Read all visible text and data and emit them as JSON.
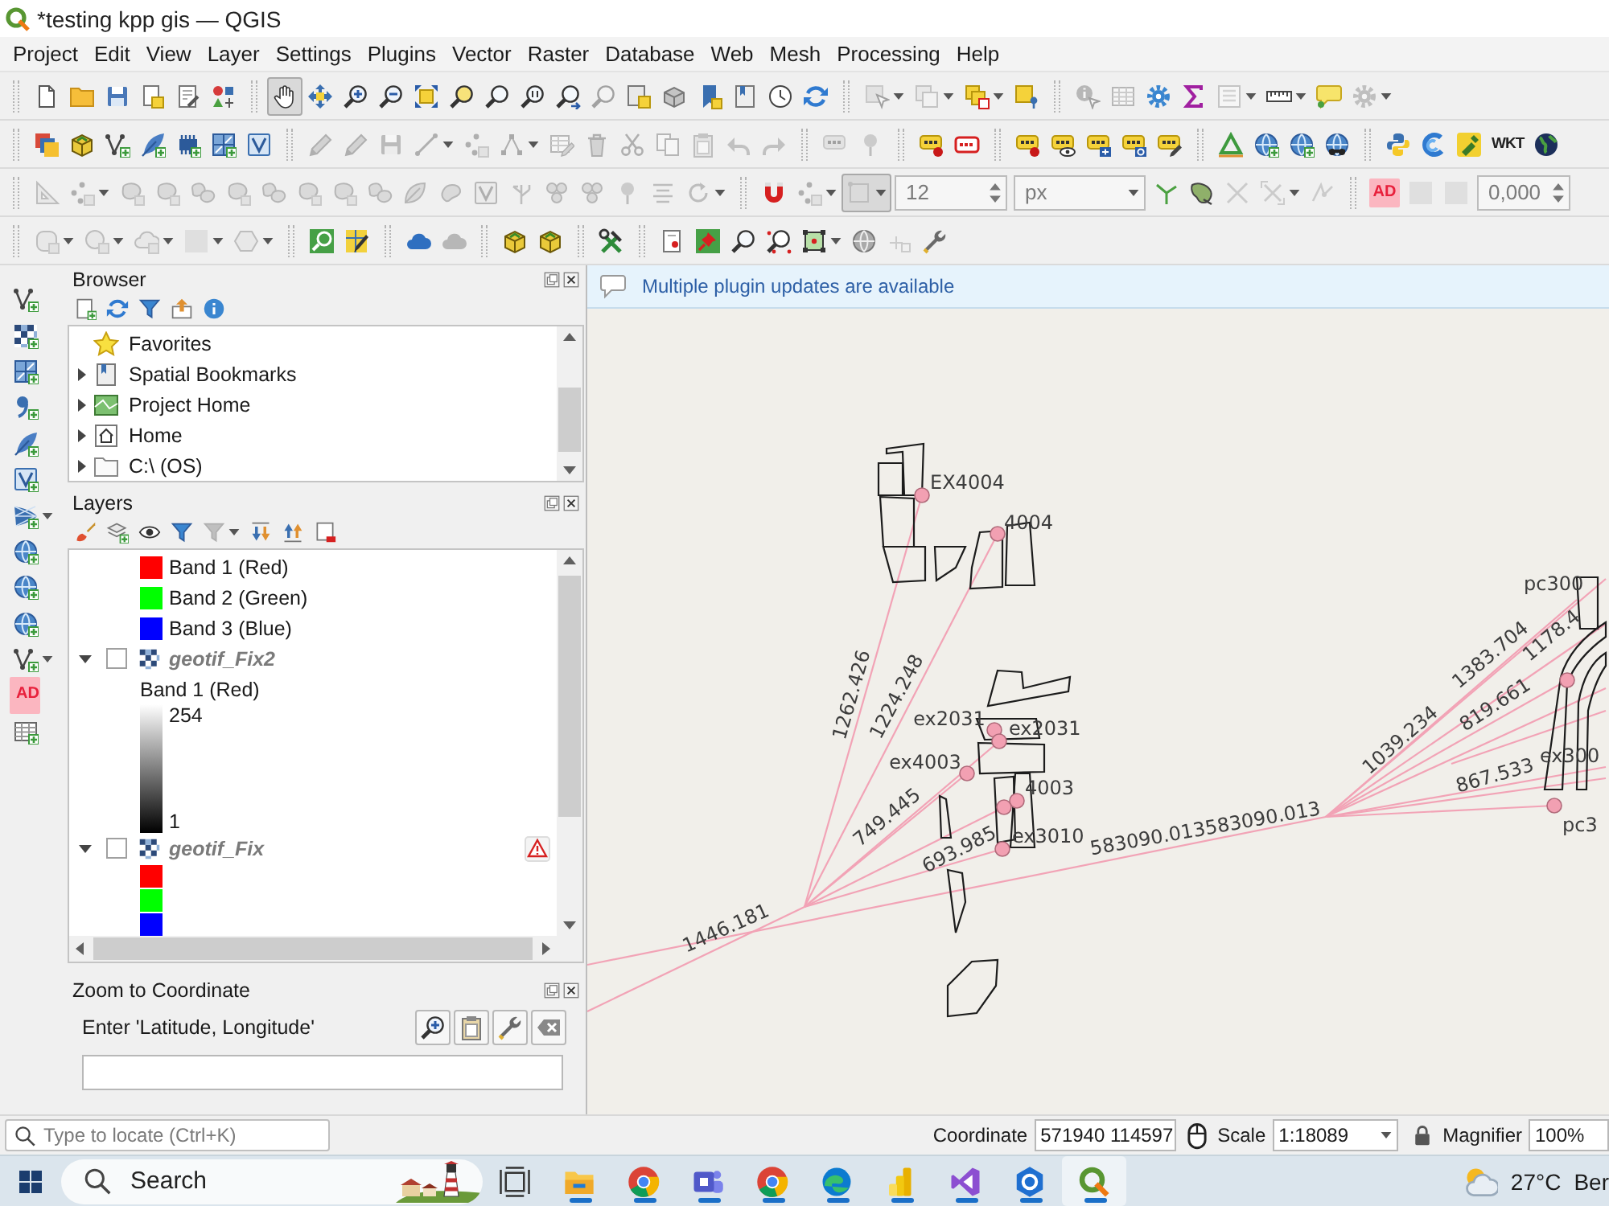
{
  "window": {
    "title": "*testing kpp gis — QGIS"
  },
  "menu": [
    "Project",
    "Edit",
    "View",
    "Layer",
    "Settings",
    "Plugins",
    "Vector",
    "Raster",
    "Database",
    "Web",
    "Mesh",
    "Processing",
    "Help"
  ],
  "toolbars": [
    {
      "groups": [
        [
          {
            "kind": "button",
            "disabled": false,
            "pressed": false
          },
          {
            "kind": "button",
            "disabled": false,
            "pressed": false
          },
          {
            "kind": "button",
            "disabled": false,
            "pressed": false
          },
          {
            "kind": "button",
            "disabled": false,
            "pressed": false
          },
          {
            "kind": "button",
            "disabled": false,
            "pressed": false
          },
          {
            "kind": "button",
            "disabled": false,
            "pressed": false
          }
        ],
        [
          {
            "kind": "button",
            "disabled": false,
            "pressed": true
          },
          {
            "kind": "button",
            "disabled": false,
            "pressed": false
          },
          {
            "kind": "button",
            "disabled": false,
            "pressed": false
          },
          {
            "kind": "button",
            "disabled": false,
            "pressed": false
          },
          {
            "kind": "button",
            "disabled": false,
            "pressed": false
          },
          {
            "kind": "button",
            "disabled": false,
            "pressed": false
          },
          {
            "kind": "button",
            "disabled": false,
            "pressed": false
          },
          {
            "kind": "button",
            "disabled": false,
            "pressed": false
          },
          {
            "kind": "button",
            "disabled": false,
            "pressed": false
          },
          {
            "kind": "button",
            "disabled": true,
            "pressed": false
          },
          {
            "kind": "button",
            "disabled": false,
            "pressed": false
          },
          {
            "kind": "button",
            "disabled": false,
            "pressed": false
          },
          {
            "kind": "button",
            "disabled": false,
            "pressed": false
          },
          {
            "kind": "button",
            "disabled": false,
            "pressed": false
          },
          {
            "kind": "button",
            "disabled": false,
            "pressed": false
          },
          {
            "kind": "button",
            "disabled": false,
            "pressed": false
          }
        ],
        [
          {
            "kind": "button",
            "disabled": true,
            "pressed": false,
            "dropdown": true
          },
          {
            "kind": "button",
            "disabled": true,
            "pressed": false,
            "dropdown": true
          },
          {
            "kind": "button",
            "disabled": false,
            "pressed": false,
            "dropdown": true
          },
          {
            "kind": "button",
            "disabled": false,
            "pressed": false
          }
        ],
        [
          {
            "kind": "button",
            "disabled": true,
            "pressed": false
          },
          {
            "kind": "button",
            "disabled": true,
            "pressed": false
          },
          {
            "kind": "button",
            "disabled": false,
            "pressed": false
          },
          {
            "kind": "button",
            "disabled": false,
            "pressed": false
          },
          {
            "kind": "button",
            "disabled": true,
            "pressed": false,
            "dropdown": true
          },
          {
            "kind": "button",
            "disabled": false,
            "pressed": false,
            "dropdown": true
          },
          {
            "kind": "button",
            "disabled": false,
            "pressed": false
          },
          {
            "kind": "button",
            "disabled": true,
            "pressed": false,
            "dropdown": true
          }
        ]
      ]
    },
    {
      "groups": [
        [
          {
            "kind": "button",
            "disabled": false,
            "pressed": false
          },
          {
            "kind": "button",
            "disabled": false,
            "pressed": false
          },
          {
            "kind": "button",
            "disabled": false,
            "pressed": false
          },
          {
            "kind": "button",
            "disabled": false,
            "pressed": false
          },
          {
            "kind": "button",
            "disabled": false,
            "pressed": false
          },
          {
            "kind": "button",
            "disabled": false,
            "pressed": false
          },
          {
            "kind": "button",
            "disabled": false,
            "pressed": false
          }
        ],
        [
          {
            "kind": "button",
            "disabled": true,
            "pressed": false
          },
          {
            "kind": "button",
            "disabled": true,
            "pressed": false
          },
          {
            "kind": "button",
            "disabled": true,
            "pressed": false
          },
          {
            "kind": "button",
            "disabled": true,
            "pressed": false,
            "dropdown": true
          },
          {
            "kind": "button",
            "disabled": true,
            "pressed": false
          },
          {
            "kind": "button",
            "disabled": true,
            "pressed": false,
            "dropdown": true
          },
          {
            "kind": "button",
            "disabled": true,
            "pressed": false
          },
          {
            "kind": "button",
            "disabled": true,
            "pressed": false
          },
          {
            "kind": "button",
            "disabled": true,
            "pressed": false
          },
          {
            "kind": "button",
            "disabled": true,
            "pressed": false
          },
          {
            "kind": "button",
            "disabled": true,
            "pressed": false
          },
          {
            "kind": "button",
            "disabled": true,
            "pressed": false
          },
          {
            "kind": "button",
            "disabled": true,
            "pressed": false
          }
        ],
        [
          {
            "kind": "button",
            "disabled": true,
            "pressed": false
          },
          {
            "kind": "button",
            "disabled": true,
            "pressed": false
          }
        ],
        [
          {
            "kind": "button",
            "disabled": false,
            "pressed": false
          },
          {
            "kind": "button",
            "disabled": false,
            "pressed": false
          }
        ],
        [
          {
            "kind": "button",
            "disabled": false,
            "pressed": false
          },
          {
            "kind": "button",
            "disabled": false,
            "pressed": false
          },
          {
            "kind": "button",
            "disabled": false,
            "pressed": false
          },
          {
            "kind": "button",
            "disabled": false,
            "pressed": false
          },
          {
            "kind": "button",
            "disabled": false,
            "pressed": false
          }
        ],
        [
          {
            "kind": "button",
            "disabled": false,
            "pressed": false
          },
          {
            "kind": "button",
            "disabled": false,
            "pressed": false
          },
          {
            "kind": "button",
            "disabled": false,
            "pressed": false
          },
          {
            "kind": "button",
            "disabled": false,
            "pressed": false
          }
        ],
        [
          {
            "kind": "button",
            "disabled": false,
            "pressed": false
          },
          {
            "kind": "button",
            "disabled": false,
            "pressed": false
          },
          {
            "kind": "button",
            "disabled": false,
            "pressed": false
          },
          {
            "kind": "text_button",
            "text": "WKT",
            "disabled": false,
            "pressed": false
          },
          {
            "kind": "button",
            "disabled": false,
            "pressed": false
          }
        ]
      ]
    },
    {
      "groups": [
        [
          {
            "kind": "button",
            "disabled": true,
            "pressed": false
          },
          {
            "kind": "button",
            "disabled": true,
            "pressed": false,
            "dropdown": true
          },
          {
            "kind": "button",
            "disabled": true,
            "pressed": false
          },
          {
            "kind": "button",
            "disabled": true,
            "pressed": false
          },
          {
            "kind": "button",
            "disabled": true,
            "pressed": false
          },
          {
            "kind": "button",
            "disabled": true,
            "pressed": false
          },
          {
            "kind": "button",
            "disabled": true,
            "pressed": false
          },
          {
            "kind": "button",
            "disabled": true,
            "pressed": false
          },
          {
            "kind": "button",
            "disabled": true,
            "pressed": false
          },
          {
            "kind": "button",
            "disabled": true,
            "pressed": false
          },
          {
            "kind": "button",
            "disabled": true,
            "pressed": false
          },
          {
            "kind": "button",
            "disabled": true,
            "pressed": false
          },
          {
            "kind": "button",
            "disabled": true,
            "pressed": false
          },
          {
            "kind": "button",
            "disabled": true,
            "pressed": false
          },
          {
            "kind": "button",
            "disabled": true,
            "pressed": false
          },
          {
            "kind": "button",
            "disabled": true,
            "pressed": false
          },
          {
            "kind": "button",
            "disabled": true,
            "pressed": false
          },
          {
            "kind": "button",
            "disabled": true,
            "pressed": false
          },
          {
            "kind": "button",
            "disabled": true,
            "pressed": false,
            "dropdown": true
          }
        ],
        [
          {
            "kind": "button",
            "disabled": false,
            "pressed": false
          },
          {
            "kind": "button",
            "disabled": true,
            "pressed": false,
            "dropdown": true
          },
          {
            "kind": "button",
            "disabled": true,
            "pressed": true,
            "dropdown": true
          },
          {
            "kind": "spinbox",
            "value": "12",
            "disabled": true
          },
          {
            "kind": "combo",
            "value": "px",
            "disabled": true
          },
          {
            "kind": "button",
            "disabled": false,
            "pressed": false
          },
          {
            "kind": "button",
            "disabled": false,
            "pressed": false
          },
          {
            "kind": "button",
            "disabled": true,
            "pressed": false
          },
          {
            "kind": "button",
            "disabled": true,
            "pressed": false,
            "dropdown": true
          },
          {
            "kind": "button",
            "disabled": true,
            "pressed": false
          }
        ],
        [
          {
            "kind": "text_button",
            "text": "AD",
            "disabled": false,
            "pressed": false
          },
          {
            "kind": "button",
            "disabled": true,
            "pressed": false
          },
          {
            "kind": "button",
            "disabled": true,
            "pressed": false
          },
          {
            "kind": "spinbox",
            "value": "0,000",
            "disabled": true
          }
        ]
      ]
    },
    {
      "groups": [
        [
          {
            "kind": "button",
            "disabled": true,
            "pressed": false,
            "dropdown": true
          },
          {
            "kind": "button",
            "disabled": true,
            "pressed": false,
            "dropdown": true
          },
          {
            "kind": "button",
            "disabled": true,
            "pressed": false,
            "dropdown": true
          },
          {
            "kind": "button",
            "disabled": true,
            "pressed": false,
            "dropdown": true
          },
          {
            "kind": "button",
            "disabled": true,
            "pressed": false,
            "dropdown": true
          }
        ],
        [
          {
            "kind": "button",
            "disabled": false,
            "pressed": false
          },
          {
            "kind": "button",
            "disabled": false,
            "pressed": false
          }
        ],
        [
          {
            "kind": "button",
            "disabled": false,
            "pressed": false
          },
          {
            "kind": "button",
            "disabled": true,
            "pressed": false
          }
        ],
        [
          {
            "kind": "button",
            "disabled": false,
            "pressed": false
          },
          {
            "kind": "button",
            "disabled": false,
            "pressed": false
          }
        ],
        [
          {
            "kind": "button",
            "disabled": false,
            "pressed": false
          }
        ],
        [
          {
            "kind": "button",
            "disabled": false,
            "pressed": false
          },
          {
            "kind": "button",
            "disabled": false,
            "pressed": false
          },
          {
            "kind": "button",
            "disabled": false,
            "pressed": false
          },
          {
            "kind": "button",
            "disabled": false,
            "pressed": false
          },
          {
            "kind": "button",
            "disabled": false,
            "pressed": false,
            "dropdown": true
          },
          {
            "kind": "button",
            "disabled": false,
            "pressed": false
          },
          {
            "kind": "button",
            "disabled": true,
            "pressed": false
          },
          {
            "kind": "button",
            "disabled": false,
            "pressed": false
          }
        ]
      ]
    }
  ],
  "left_toolbar": [
    {
      "kind": "button",
      "disabled": false,
      "pressed": false
    },
    {
      "kind": "button",
      "disabled": false,
      "pressed": false
    },
    {
      "kind": "button",
      "disabled": false,
      "pressed": false
    },
    {
      "kind": "button",
      "disabled": false,
      "pressed": false
    },
    {
      "kind": "button",
      "disabled": false,
      "pressed": false
    },
    {
      "kind": "button",
      "disabled": false,
      "pressed": false
    },
    {
      "kind": "button",
      "disabled": false,
      "pressed": false,
      "dropdown": true
    },
    {
      "kind": "button",
      "disabled": false,
      "pressed": false
    },
    {
      "kind": "button",
      "disabled": false,
      "pressed": false
    },
    {
      "kind": "button",
      "disabled": false,
      "pressed": false
    },
    {
      "kind": "button",
      "disabled": false,
      "pressed": false,
      "dropdown": true
    },
    {
      "kind": "text_button",
      "text": "AD",
      "disabled": false,
      "pressed": false
    },
    {
      "kind": "button",
      "disabled": false,
      "pressed": false
    }
  ],
  "browser": {
    "title": "Browser",
    "toolbar": [
      {
        "kind": "button",
        "disabled": false,
        "pressed": false
      },
      {
        "kind": "button",
        "disabled": false,
        "pressed": false
      },
      {
        "kind": "button",
        "disabled": false,
        "pressed": false
      },
      {
        "kind": "button",
        "disabled": false,
        "pressed": false
      },
      {
        "kind": "button",
        "disabled": false,
        "pressed": false
      }
    ],
    "items": [
      {
        "label": "Favorites",
        "expandable": false
      },
      {
        "label": "Spatial Bookmarks",
        "expandable": true
      },
      {
        "label": "Project Home",
        "expandable": true
      },
      {
        "label": "Home",
        "expandable": true
      },
      {
        "label": "C:\\ (OS)",
        "expandable": true
      }
    ]
  },
  "layers": {
    "title": "Layers",
    "toolbar": [
      {
        "kind": "button",
        "disabled": false,
        "pressed": false
      },
      {
        "kind": "button",
        "disabled": false,
        "pressed": false
      },
      {
        "kind": "button",
        "disabled": false,
        "pressed": false
      },
      {
        "kind": "button",
        "disabled": false,
        "pressed": false
      },
      {
        "kind": "button",
        "disabled": true,
        "pressed": false,
        "dropdown": true
      },
      {
        "kind": "button",
        "disabled": false,
        "pressed": false
      },
      {
        "kind": "button",
        "disabled": false,
        "pressed": false
      },
      {
        "kind": "button",
        "disabled": false,
        "pressed": false
      }
    ],
    "items": [
      {
        "kind": "legend",
        "label": "Band 1 (Red)",
        "color": "#ff0000"
      },
      {
        "kind": "legend",
        "label": "Band 2 (Green)",
        "color": "#00ff00"
      },
      {
        "kind": "legend",
        "label": "Band 3 (Blue)",
        "color": "#0000ff"
      },
      {
        "kind": "layer",
        "label": "geotif_Fix2",
        "expanded": true,
        "checked": false,
        "warning": false,
        "children": [
          {
            "kind": "band",
            "label": "Band 1 (Red)"
          },
          {
            "kind": "ramp",
            "max": "254",
            "min": "1"
          }
        ]
      },
      {
        "kind": "layer",
        "label": "geotif_Fix",
        "expanded": true,
        "checked": false,
        "warning": true,
        "children": [
          {
            "kind": "legend",
            "color": "#ff0000"
          },
          {
            "kind": "legend",
            "color": "#00ff00"
          },
          {
            "kind": "legend",
            "color": "#0000ff"
          }
        ]
      }
    ]
  },
  "zoom_to_coordinate": {
    "title": "Zoom to Coordinate",
    "label": "Enter 'Latitude, Longitude'"
  },
  "message_bar": {
    "text": "Multiple plugin updates are available"
  },
  "map": {
    "labels": [
      "EX4004",
      "4004",
      "1262.426",
      "1224.248",
      "ex2031",
      "ex2031",
      "ex4003",
      "4003",
      "749.445",
      "693.985",
      "ex3010",
      "583090.013583090.013",
      "1446.181",
      "1039.234",
      "1383.704",
      "819.661",
      "1178.4",
      "867.533",
      "pc300",
      "ex300",
      "pc3"
    ]
  },
  "status_bar": {
    "locator": {
      "placeholder": "Type to locate (Ctrl+K)"
    },
    "coordinate_label": "Coordinate",
    "coordinate": "571940 114597",
    "scale_label": "Scale",
    "scale": "1:18089",
    "magnifier_label": "Magnifier",
    "magnifier": "100%"
  },
  "taskbar": {
    "search": {
      "placeholder": "Search"
    },
    "apps": [
      {
        "running": true,
        "selected": false
      },
      {
        "running": true,
        "selected": false
      },
      {
        "running": true,
        "selected": false
      },
      {
        "running": true,
        "selected": false
      },
      {
        "running": true,
        "selected": false
      },
      {
        "running": true,
        "selected": false
      },
      {
        "running": true,
        "selected": false
      },
      {
        "running": true,
        "selected": false
      },
      {
        "running": true,
        "selected": true
      }
    ],
    "temperature": "27°C",
    "weather": "Ber"
  }
}
